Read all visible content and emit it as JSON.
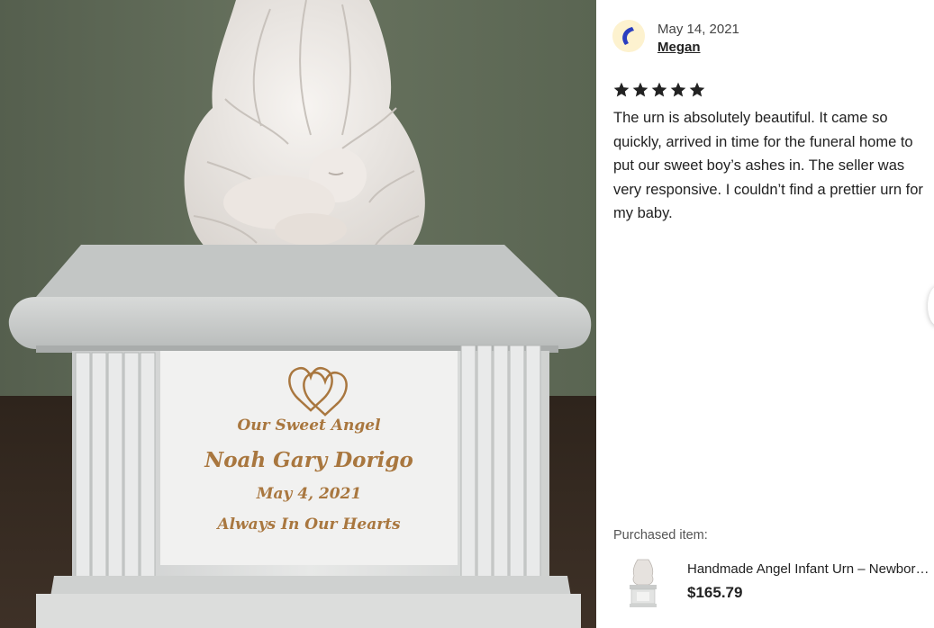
{
  "photo": {
    "engraving": {
      "line1": "Our Sweet Angel",
      "line2": "Noah Gary Dorigo",
      "line3": "May 4, 2021",
      "line4": "Always In Our Hearts"
    },
    "icon": "double-heart-icon"
  },
  "review": {
    "date": "May 14, 2021",
    "reviewer": "Megan",
    "rating": 5,
    "rating_max": 5,
    "text": "The urn is absolutely beautiful. It came so quickly, arrived in time for the funeral home to put our sweet boy’s ashes in. The seller was very responsive. I couldn’t find a prettier urn for my baby."
  },
  "purchase": {
    "label": "Purchased item:",
    "title": "Handmade Angel Infant Urn – Newborn Baby Urn",
    "price": "$165.79"
  },
  "colors": {
    "star": "#222222",
    "avatar_bg": "#fdf2cf",
    "avatar_accent": "#2a3ec0",
    "engraving": "#a9773f"
  },
  "icons": {
    "star": "star-icon",
    "avatar": "avatar",
    "next": "chevron-right-icon"
  }
}
